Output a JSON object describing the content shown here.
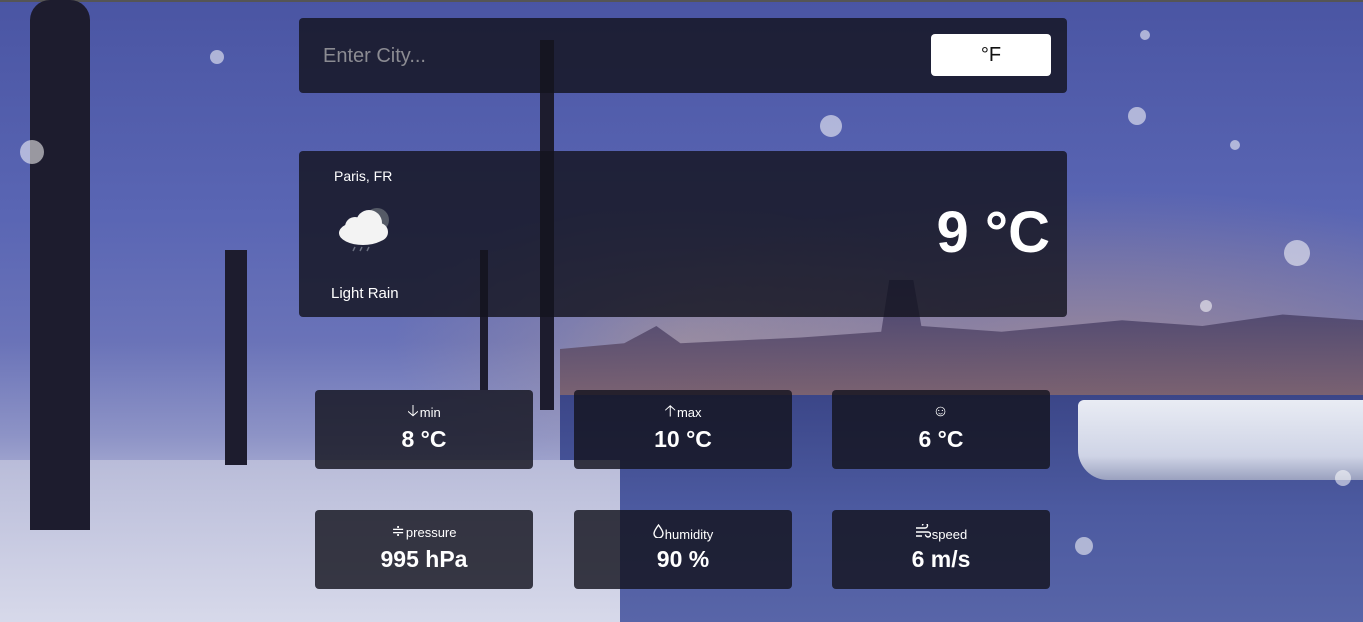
{
  "search": {
    "placeholder": "Enter City...",
    "value": ""
  },
  "unit_toggle": {
    "label": "°F"
  },
  "current": {
    "location": "Paris, FR",
    "description": "Light Rain",
    "temperature": "9 °C",
    "icon": "cloud-rain-icon"
  },
  "stats": {
    "min": {
      "label": "min",
      "value": "8 °C",
      "icon": "arrow-down-icon"
    },
    "max": {
      "label": "max",
      "value": "10 °C",
      "icon": "arrow-up-icon"
    },
    "feels_like": {
      "label": "",
      "value": "6 °C",
      "icon": "smile-icon"
    },
    "pressure": {
      "label": "pressure",
      "value": "995 hPa",
      "icon": "pressure-icon"
    },
    "humidity": {
      "label": "humidity",
      "value": "90 %",
      "icon": "droplet-icon"
    },
    "speed": {
      "label": "speed",
      "value": "6 m/s",
      "icon": "wind-icon"
    }
  }
}
